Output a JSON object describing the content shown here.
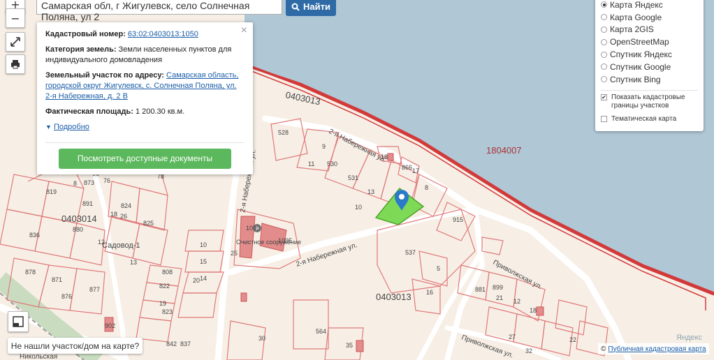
{
  "search": {
    "value": "Самарская обл, г Жигулевск, село Солнечная Поляна, ул 2",
    "button_label": "Найти"
  },
  "controls": {
    "zoom_in": "+",
    "zoom_out": "−"
  },
  "popup": {
    "cadastral_label": "Кадастровый номер:",
    "cadastral_value": "63:02:0403013:1050",
    "category_label": "Категория земель:",
    "category_value": "Земли населенных пунктов для индивидуального домовладения",
    "address_label": "Земельный участок по адресу:",
    "address_value": "Самарская область, городской округ Жигулевск, с. Солнечная Поляна, ул. 2-я Набережная, д. 2 В",
    "area_label": "Фактическая площадь:",
    "area_value": "1 200.30 кв.м.",
    "more_label": "Подробно",
    "docs_button": "Посмотреть доступные документы",
    "close": "×"
  },
  "layers": {
    "options": [
      {
        "label": "Карта Яндекс",
        "selected": true
      },
      {
        "label": "Карта Google",
        "selected": false
      },
      {
        "label": "Карта 2GIS",
        "selected": false
      },
      {
        "label": "OpenStreetMap",
        "selected": false
      },
      {
        "label": "Спутник Яндекс",
        "selected": false
      },
      {
        "label": "Спутник Google",
        "selected": false
      },
      {
        "label": "Спутник Bing",
        "selected": false
      }
    ],
    "show_borders_label": "Показать кадастровые границы участков",
    "show_borders_checked": true,
    "thematic_label": "Тематическая карта",
    "thematic_checked": false
  },
  "not_found_button": "Не нашли участок/дом на карте?",
  "attribution": {
    "prefix": "©",
    "link": "Публичная кадастровая карта",
    "watermark": "Яндекс"
  },
  "map_labels": {
    "quarter_top": "0403013",
    "quarter_main": "0403013",
    "quarter_left": "0403014",
    "water_block": "1804007",
    "street_nab_1": "2-я Набережная ул.",
    "street_nab_2": "2-я Набережная ул.",
    "street_nab_3": "2-я Набережная ул.",
    "street_privol_1": "Приволжская ул.",
    "street_privol_2": "Приволжская ул.",
    "street_nikol": "Никольская",
    "settlement": "Садовод-1",
    "facility": "Очистное сооружение",
    "parcels": [
      "528",
      "9",
      "11",
      "530",
      "531",
      "13",
      "18",
      "866",
      "17",
      "8",
      "10",
      "915",
      "537",
      "5",
      "16",
      "1096",
      "1095",
      "25",
      "10",
      "15",
      "14",
      "20",
      "808",
      "822",
      "19",
      "13",
      "26",
      "824",
      "825",
      "819",
      "880",
      "836",
      "881",
      "878",
      "871",
      "876",
      "877",
      "873",
      "891",
      "899",
      "12",
      "18",
      "32",
      "27",
      "22",
      "564",
      "30",
      "35",
      "842",
      "837",
      "902",
      "823",
      "21",
      "12",
      "8",
      "18",
      "78",
      "96",
      "76"
    ]
  },
  "colors": {
    "land": "#f7efe6",
    "water": "#b0c7d6",
    "parcel_border": "#e07a7a",
    "quarter_border": "#d23a3a",
    "selected_parcel": "#7ed957",
    "marker": "#2a7ac9",
    "road": "#ffffff",
    "facility": "#e38c8c"
  },
  "icons": {
    "fullscreen": "expand-icon",
    "print": "print-icon",
    "layers_bottom": "map-layers-icon",
    "search": "search-icon",
    "marker": "map-marker-icon"
  }
}
